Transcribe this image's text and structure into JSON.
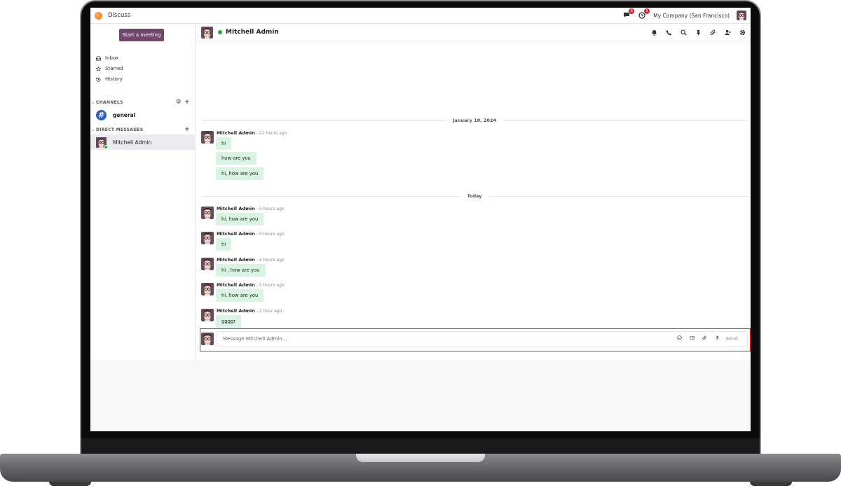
{
  "navbar": {
    "app_name": "Discuss",
    "chat_badge": "5",
    "activity_badge": "5",
    "company": "My Company (San Francisco)"
  },
  "sidebar": {
    "start_meeting": "Start a meeting",
    "links": [
      {
        "label": "Inbox",
        "icon": "inbox-icon"
      },
      {
        "label": "Starred",
        "icon": "star-icon"
      },
      {
        "label": "History",
        "icon": "history-icon"
      }
    ],
    "channels_heading": "CHANNELS",
    "channels": [
      {
        "label": "general"
      }
    ],
    "dm_heading": "DIRECT MESSAGES",
    "direct_messages": [
      {
        "label": "Mitchell Admin",
        "status": "online"
      }
    ]
  },
  "thread": {
    "title": "Mitchell Admin",
    "date_1": "January 18, 2024",
    "date_2": "Today",
    "groups": [
      {
        "author": "Mitchell Admin",
        "time": "- 22 hours ago",
        "messages": [
          "hi",
          "how are you",
          "hi, how are you"
        ]
      },
      {
        "author": "Mitchell Admin",
        "time": "- 5 hours ago",
        "messages": [
          "hi, how are you"
        ]
      },
      {
        "author": "Mitchell Admin",
        "time": "- 5 hours ago",
        "messages": [
          "hi"
        ]
      },
      {
        "author": "Mitchell Admin",
        "time": "- 5 hours ago",
        "messages": [
          "hi , how are you"
        ]
      },
      {
        "author": "Mitchell Admin",
        "time": "- 5 hours ago",
        "messages": [
          "hi, how are you"
        ]
      },
      {
        "author": "Mitchell Admin",
        "time": "- 1 hour ago",
        "messages": [
          "ggggr"
        ]
      }
    ]
  },
  "composer": {
    "placeholder": "Message Mitchell Admin…",
    "value": "",
    "send_label": "Send"
  },
  "colors": {
    "brand": "#71486c",
    "bubble": "#d9f4e2",
    "online": "#28a745",
    "badge": "#e0262c",
    "highlight_frame": "#e12424",
    "channel": "#2f5ec4"
  }
}
